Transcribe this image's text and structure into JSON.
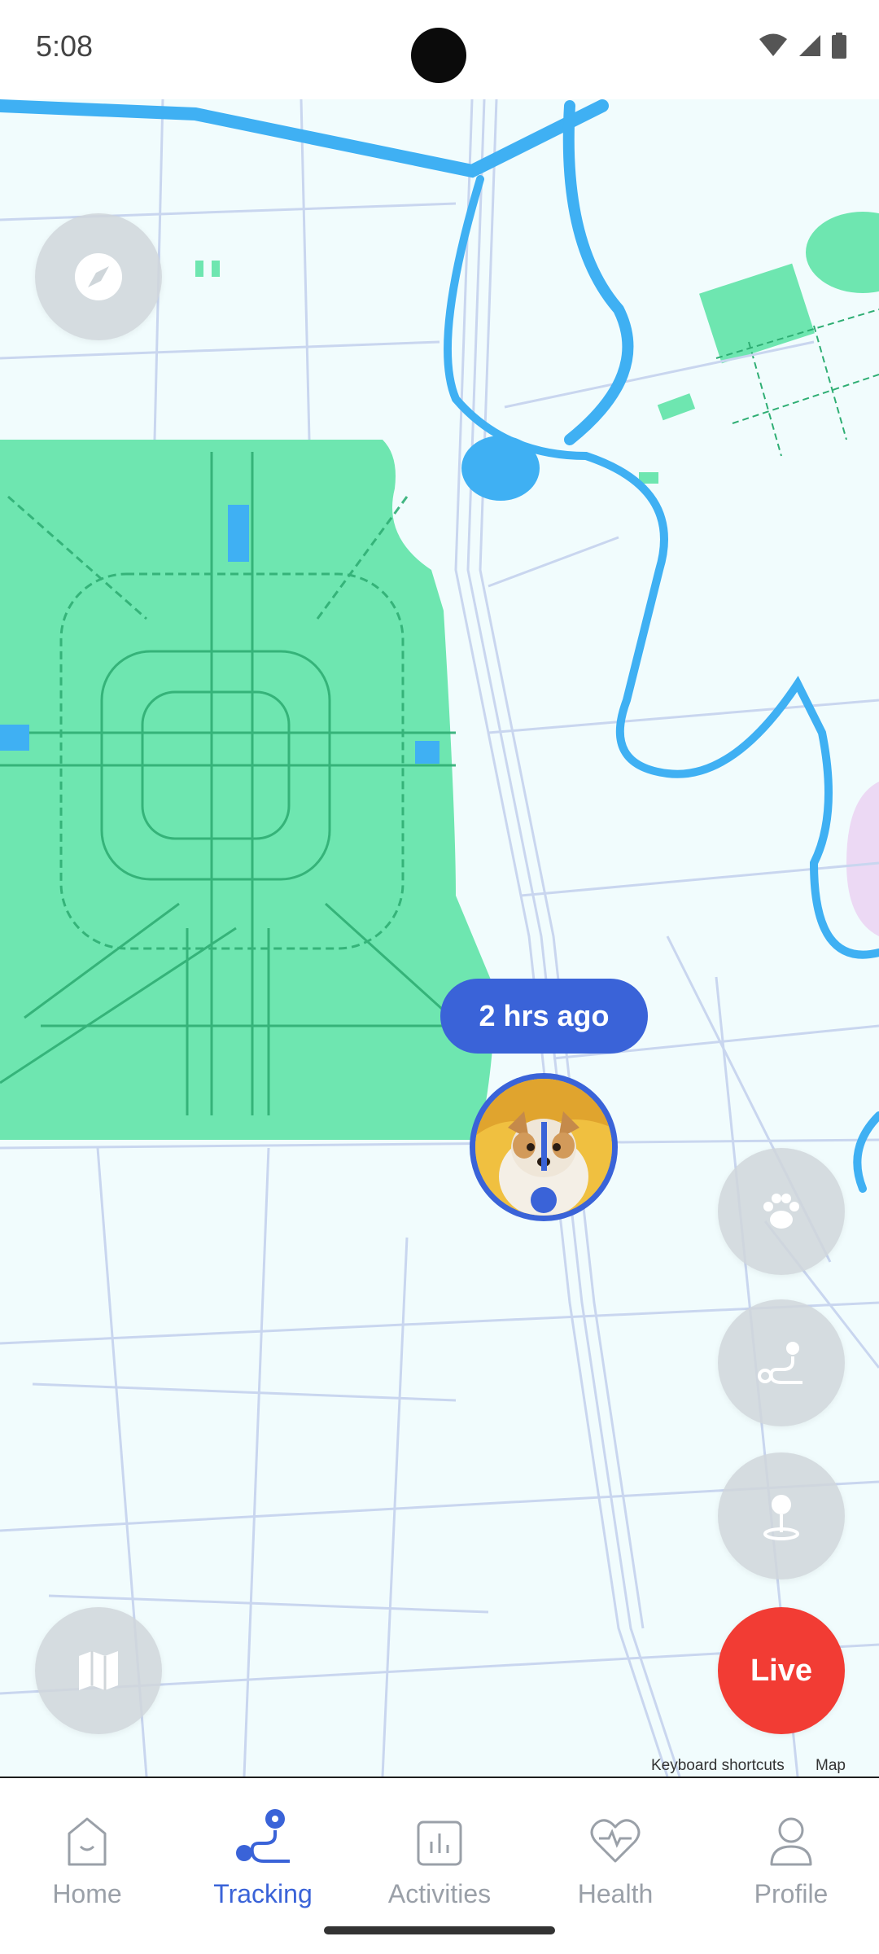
{
  "status_bar": {
    "time": "5:08"
  },
  "map": {
    "time_badge": "2 hrs ago",
    "attribution": [
      "Keyboard shortcuts",
      "Map data"
    ],
    "buttons": {
      "compass": "compass-icon",
      "map_type": "map-icon",
      "paw": "paw-icon",
      "route": "route-icon",
      "location": "location-pin-icon",
      "live_label": "Live"
    },
    "colors": {
      "accent": "#3a63d8",
      "live": "#f23c34",
      "park": "#6ee6b0",
      "water": "#3fb0f3",
      "road": "#c9d6ef"
    }
  },
  "bottom_nav": {
    "items": [
      {
        "label": "Home",
        "icon": "home-icon"
      },
      {
        "label": "Tracking",
        "icon": "tracking-icon",
        "active": true
      },
      {
        "label": "Activities",
        "icon": "activities-icon"
      },
      {
        "label": "Health",
        "icon": "health-icon"
      },
      {
        "label": "Profile",
        "icon": "profile-icon"
      }
    ]
  }
}
